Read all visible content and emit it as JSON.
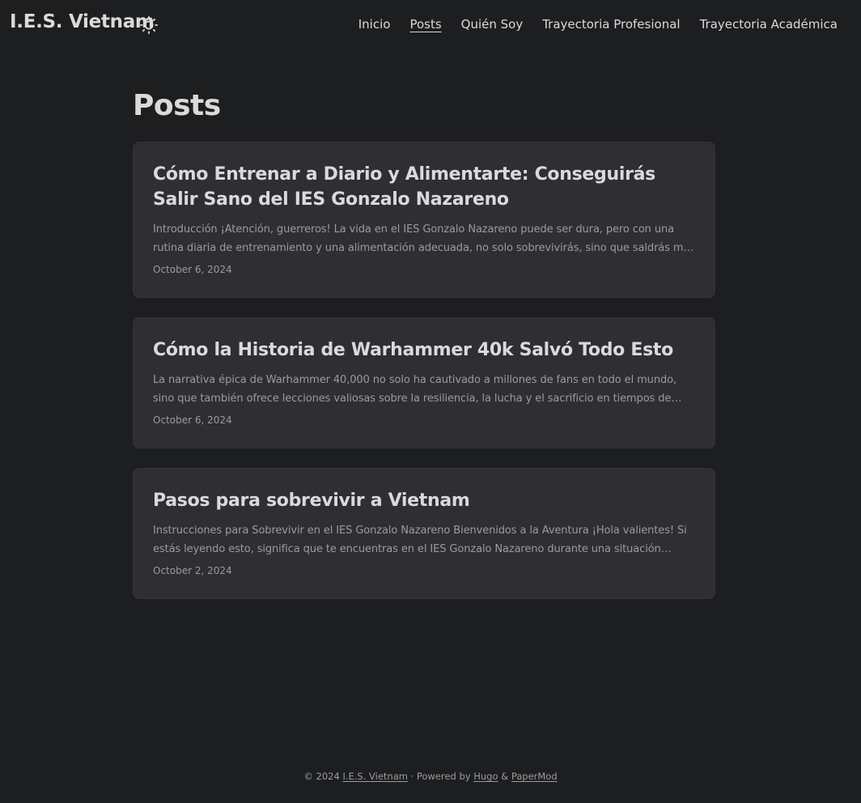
{
  "header": {
    "logo": "I.E.S. Vietnam",
    "theme_toggle_icon": "sun-icon",
    "nav": [
      {
        "label": "Inicio",
        "active": false
      },
      {
        "label": "Posts",
        "active": true
      },
      {
        "label": "Quién Soy",
        "active": false
      },
      {
        "label": "Trayectoria Profesional",
        "active": false
      },
      {
        "label": "Trayectoria Académica",
        "active": false
      }
    ]
  },
  "main": {
    "title": "Posts",
    "posts": [
      {
        "title": "Cómo Entrenar a Diario y Alimentarte: Conseguirás Salir Sano del IES Gonzalo Nazareno",
        "summary": "Introducción ¡Atención, guerreros! La vida en el IES Gonzalo Nazareno puede ser dura, pero con una rutina diaria de entrenamiento y una alimentación adecuada, no solo sobrevivirás, sino que saldrás más fuerte y…",
        "date": "October 6, 2024"
      },
      {
        "title": "Cómo la Historia de Warhammer 40k Salvó Todo Esto",
        "summary": "La narrativa épica de Warhammer 40,000 no solo ha cautivado a millones de fans en todo el mundo, sino que también ofrece lecciones valiosas sobre la resiliencia, la lucha y el sacrificio en tiempos de oscuridad. …",
        "date": "October 6, 2024"
      },
      {
        "title": "Pasos para sobrevivir a Vietnam",
        "summary": "Instrucciones para Sobrevivir en el IES Gonzalo Nazareno Bienvenidos a la Aventura ¡Hola valientes! Si estás leyendo esto, significa que te encuentras en el IES Gonzalo Nazareno durante una situación extrema. ¡No…",
        "date": "October 2, 2024"
      }
    ]
  },
  "footer": {
    "copyright": "© 2024",
    "site_link": "I.E.S. Vietnam",
    "powered_by": "· Powered by",
    "hugo_link": "Hugo",
    "amp": "&",
    "papermod_link": "PaperMod"
  },
  "colors": {
    "background": "#1d1e20",
    "card": "#2e2e33",
    "primary_text": "#dadadb",
    "secondary_text": "#9b9c9d"
  }
}
